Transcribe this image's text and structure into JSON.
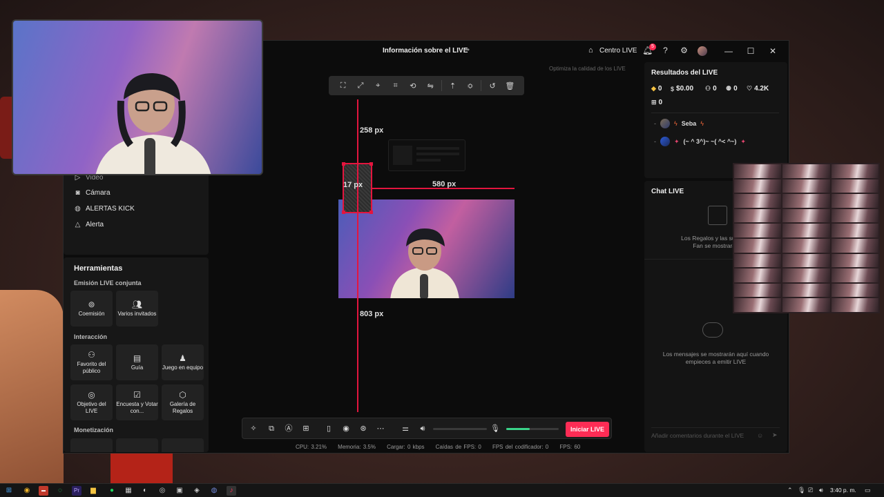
{
  "window": {
    "title": "Información sobre el LIVE",
    "home_label": "Centro LIVE",
    "notifications_count": "5",
    "optimize_hint": "Optimiza la calidad de los LIVE"
  },
  "left_panel": {
    "partial_item": "Video",
    "nav_items": [
      {
        "label": "Cámara",
        "icon": "camera-icon"
      },
      {
        "label": "ALERTAS KICK",
        "icon": "globe-icon"
      },
      {
        "label": "Alerta",
        "icon": "bell-icon"
      }
    ],
    "tools_title": "Herramientas",
    "sections": {
      "joint": "Emisión LIVE conjunta",
      "interaction": "Interacción",
      "monetization": "Monetización"
    },
    "joint_tools": [
      {
        "label": "Coemisión",
        "icon": "link-icon"
      },
      {
        "label": "Varios invitados",
        "icon": "users-icon"
      }
    ],
    "interaction_tools": [
      {
        "label": "Favorito del público",
        "icon": "star-users-icon"
      },
      {
        "label": "Guía",
        "icon": "guide-icon"
      },
      {
        "label": "Juego en equipo",
        "icon": "team-icon"
      },
      {
        "label": "Objetivo del LIVE",
        "icon": "target-icon"
      },
      {
        "label": "Encuesta y Votar con...",
        "icon": "poll-icon"
      },
      {
        "label": "Galería de Regalos",
        "icon": "gift-gallery-icon"
      }
    ]
  },
  "canvas": {
    "measure_top": "258 px",
    "measure_left": "17 px",
    "measure_right": "580 px",
    "measure_bottom": "803 px"
  },
  "controls": {
    "go_live": "Iniciar LIVE",
    "volume_level": 0,
    "mic_level": 0.45
  },
  "stats": {
    "cpu": "CPU:  3.21%",
    "memory": "Memoria:  3.5%",
    "upload": "Cargar:  0 kbps",
    "fps_drops": "Caídas de FPS:  0",
    "encoder_fps": "FPS del codificador:  0",
    "fps": "FPS:  60"
  },
  "results": {
    "title": "Resultados del LIVE",
    "diamonds": "0",
    "money": "$0.00",
    "new_followers": "0",
    "shares": "0",
    "likes": "4.2K",
    "gifts": "0",
    "viewers": [
      {
        "name": "Seba"
      },
      {
        "name": "(~ ^ 3^)~ ~( ^< ^~)"
      }
    ]
  },
  "chat": {
    "title": "Chat LIVE",
    "gifts_msg_1": "Los Regalos y las suscripc",
    "gifts_msg_2": "Fan se mostrarán",
    "empty_msg_1": "Los mensajes se mostrarán aquí cuando",
    "empty_msg_2": "empieces a emitir LIVE",
    "input_placeholder": "Añadir comentarios durante el LIVE"
  },
  "taskbar": {
    "clock": "3:40 p. m."
  },
  "colors": {
    "accent": "#fe2c55",
    "guide": "#e4153e",
    "mic_green": "#3ad48a"
  }
}
